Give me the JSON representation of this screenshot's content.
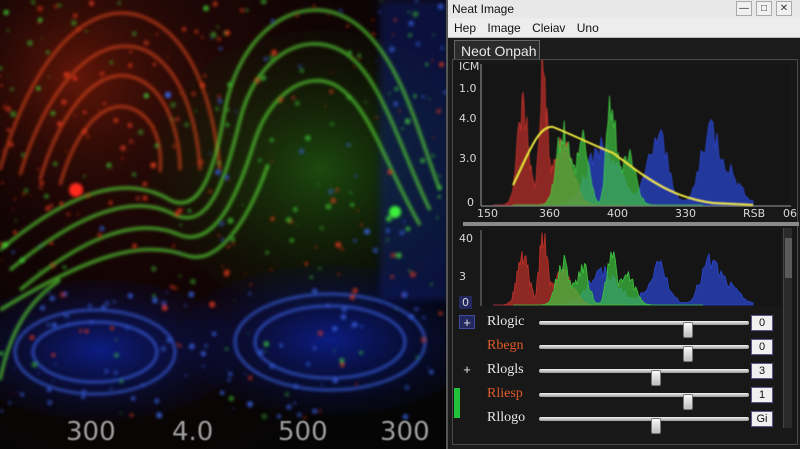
{
  "window": {
    "title": "Neat Image",
    "menu": [
      "Hep",
      "Image",
      "Cleiav",
      "Uno"
    ],
    "panel_tab": "Neot Onpah",
    "buttons": {
      "minimize": "—",
      "maximize": "□",
      "close": "✕"
    }
  },
  "left_image": {
    "ticks": [
      "300",
      "4.0",
      "500",
      "300"
    ]
  },
  "histogram_top": {
    "y_ticks": [
      "ICM",
      "1.0",
      "4.0",
      "3.0",
      "0"
    ],
    "x_ticks": [
      "150",
      "360",
      "400",
      "330",
      "RSB",
      "06"
    ]
  },
  "histogram_bottom": {
    "y_ticks": [
      "40",
      "3",
      "0"
    ]
  },
  "controls": [
    {
      "prefix": "+",
      "prefix_box": true,
      "label": "Rlogic",
      "label_color": "white",
      "value": "0",
      "position": 0.72
    },
    {
      "prefix": "",
      "prefix_box": false,
      "label": "Rbegn",
      "label_color": "red",
      "value": "0",
      "position": 0.72
    },
    {
      "prefix": "+",
      "prefix_box": false,
      "label": "Rlogls",
      "label_color": "white",
      "value": "3",
      "position": 0.56
    },
    {
      "prefix": "",
      "prefix_box": false,
      "label": "Rliesp",
      "label_color": "red",
      "value": "1",
      "position": 0.72
    },
    {
      "prefix": "",
      "prefix_box": false,
      "label": "Rllogo",
      "label_color": "white",
      "value": "Gi",
      "position": 0.56
    }
  ],
  "colors": {
    "accent_red": "#e05a2a",
    "series_red": "#c0302a",
    "series_green": "#3fc43f",
    "series_blue": "#2a44c8",
    "curve_yellow": "#e9e23a"
  }
}
